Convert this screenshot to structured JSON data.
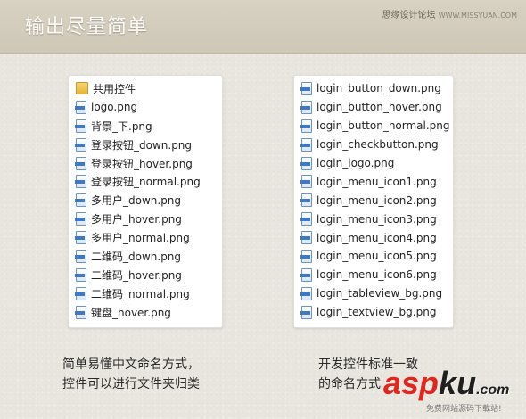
{
  "header": {
    "title": "输出尽量简单",
    "watermark_cn": "思缘设计论坛",
    "watermark_site": "WWW.MISSYUAN.COM"
  },
  "left_list": {
    "items": [
      {
        "icon": "folder-icon",
        "name": "共用控件"
      },
      {
        "icon": "png-file-icon",
        "name": "logo.png"
      },
      {
        "icon": "png-file-icon",
        "name": "背景_下.png"
      },
      {
        "icon": "png-file-icon",
        "name": "登录按钮_down.png"
      },
      {
        "icon": "png-file-icon",
        "name": "登录按钮_hover.png"
      },
      {
        "icon": "png-file-icon",
        "name": "登录按钮_normal.png"
      },
      {
        "icon": "png-file-icon",
        "name": "多用户_down.png"
      },
      {
        "icon": "png-file-icon",
        "name": "多用户_hover.png"
      },
      {
        "icon": "png-file-icon",
        "name": "多用户_normal.png"
      },
      {
        "icon": "png-file-icon",
        "name": "二维码_down.png"
      },
      {
        "icon": "png-file-icon",
        "name": "二维码_hover.png"
      },
      {
        "icon": "png-file-icon",
        "name": "二维码_normal.png"
      },
      {
        "icon": "png-file-icon",
        "name": "键盘_hover.png"
      }
    ]
  },
  "right_list": {
    "items": [
      {
        "icon": "png-file-icon",
        "name": "login_button_down.png"
      },
      {
        "icon": "png-file-icon",
        "name": "login_button_hover.png"
      },
      {
        "icon": "png-file-icon",
        "name": "login_button_normal.png"
      },
      {
        "icon": "png-file-icon",
        "name": "login_checkbutton.png"
      },
      {
        "icon": "png-file-icon",
        "name": "login_logo.png"
      },
      {
        "icon": "png-file-icon",
        "name": "login_menu_icon1.png"
      },
      {
        "icon": "png-file-icon",
        "name": "login_menu_icon2.png"
      },
      {
        "icon": "png-file-icon",
        "name": "login_menu_icon3.png"
      },
      {
        "icon": "png-file-icon",
        "name": "login_menu_icon4.png"
      },
      {
        "icon": "png-file-icon",
        "name": "login_menu_icon5.png"
      },
      {
        "icon": "png-file-icon",
        "name": "login_menu_icon6.png"
      },
      {
        "icon": "png-file-icon",
        "name": "login_tableview_bg.png"
      },
      {
        "icon": "png-file-icon",
        "name": "login_textview_bg.png"
      }
    ]
  },
  "captions": {
    "left_line1": "简单易懂中文命名方式，",
    "left_line2": "控件可以进行文件夹归类",
    "right_line1": "开发控件标准一致",
    "right_line2": "的命名方式"
  },
  "brand": {
    "asp": "asp",
    "ku": "ku",
    "dotcom": ".com",
    "sub": "免费网站源码下载站!"
  },
  "colors": {
    "background": "#e9e6df",
    "header_band": "#d2ccbc",
    "brand_red": "#e1261c"
  }
}
